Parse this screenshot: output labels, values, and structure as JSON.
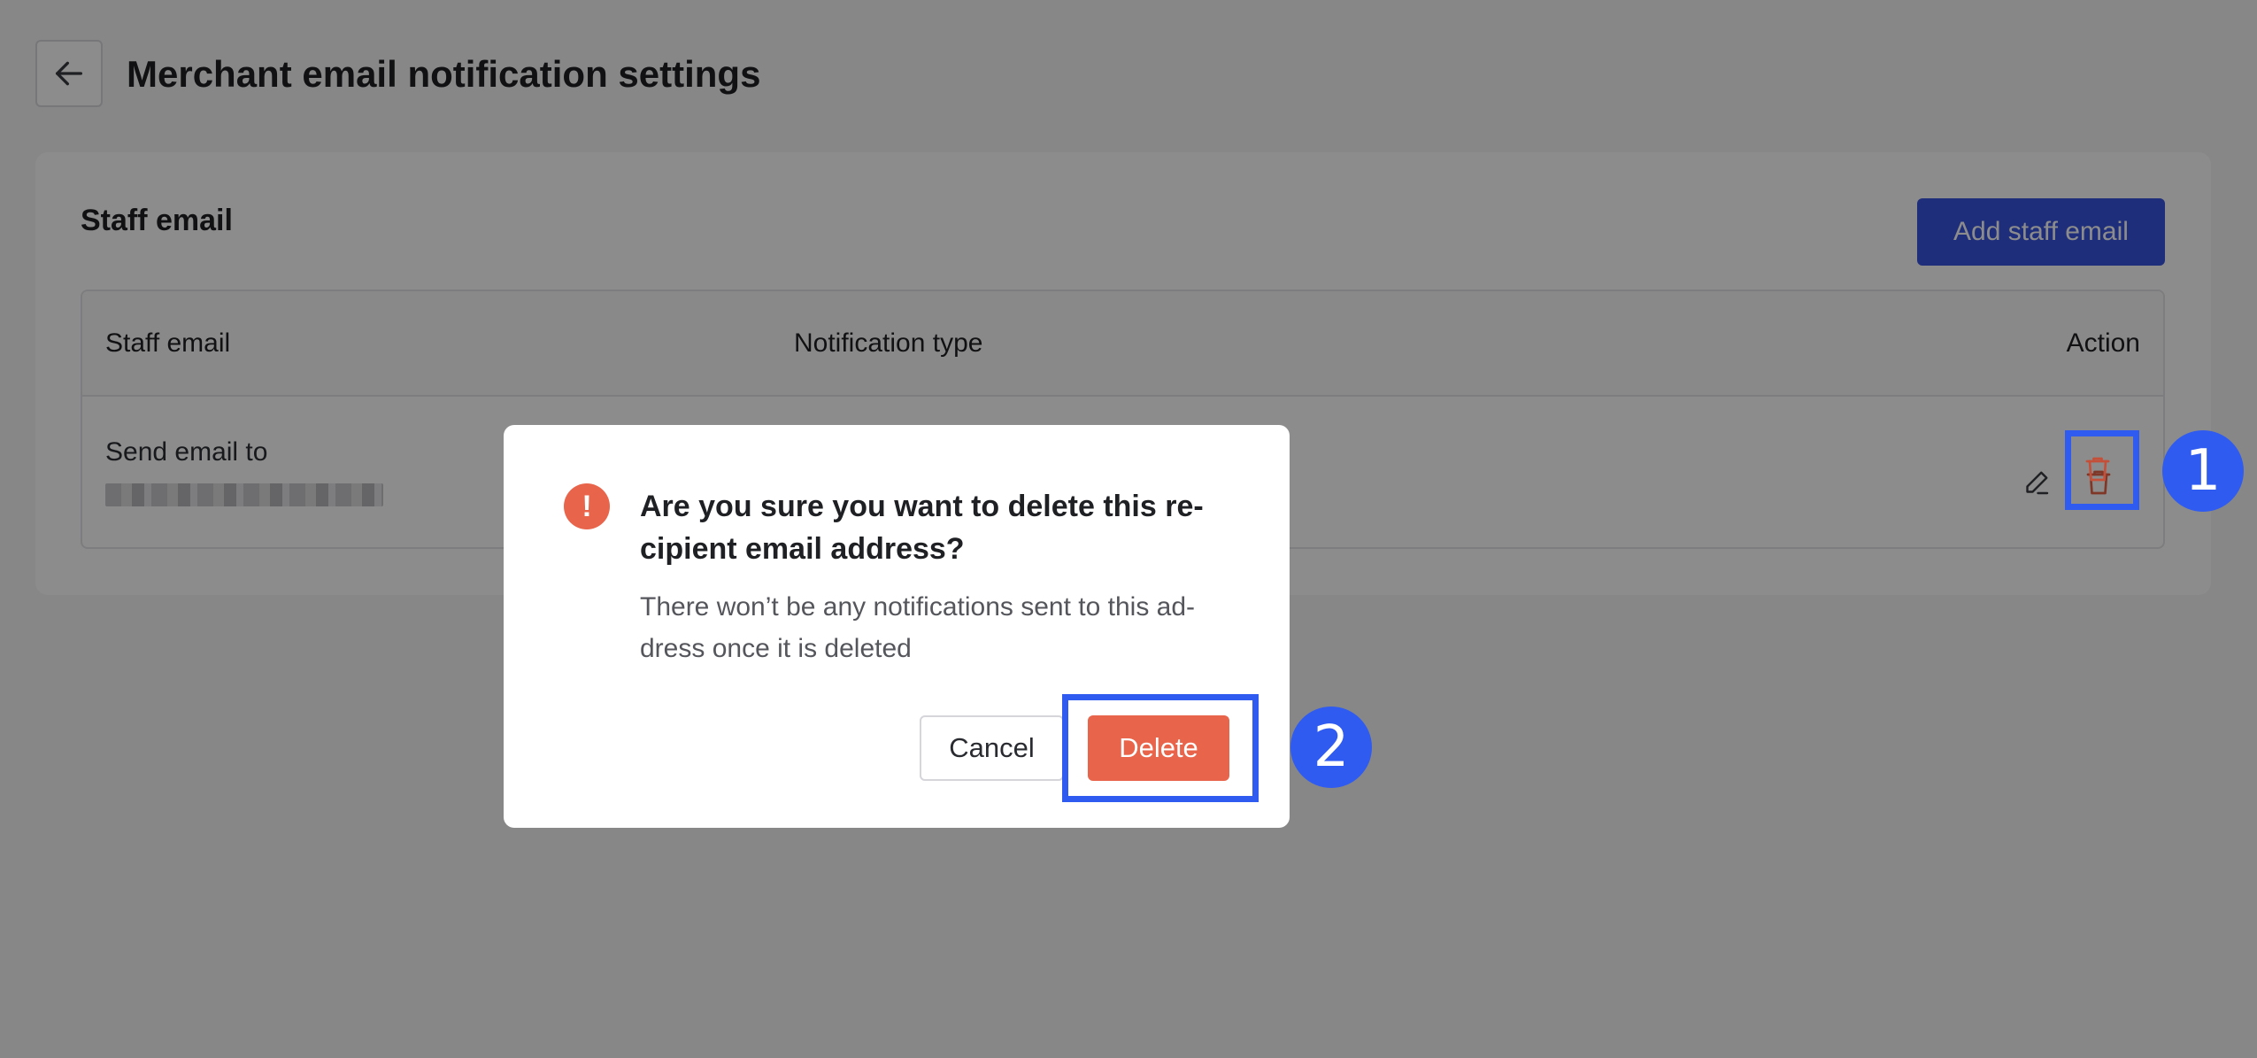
{
  "page": {
    "title": "Merchant email notification settings"
  },
  "staff_card": {
    "title": "Staff email",
    "add_button_label": "Add staff email",
    "table": {
      "columns": [
        "Staff email",
        "Notification type",
        "Action"
      ],
      "rows": [
        {
          "label": "Send email to",
          "email": "(redacted)"
        }
      ]
    }
  },
  "dialog": {
    "title": "Are you sure you want to delete this re-cipient email address?",
    "title_line1": "Are you sure you want to delete this re-",
    "title_line2": "cipient email address?",
    "body_line1": "There won’t be any notifications sent to this ad-",
    "body_line2": "dress once it is deleted",
    "icon_glyph": "!",
    "cancel_label": "Cancel",
    "delete_label": "Delete"
  },
  "annotations": [
    {
      "number": "1",
      "target": "trash-icon"
    },
    {
      "number": "2",
      "target": "delete-button"
    }
  ],
  "colors": {
    "primary": "#3a55e0",
    "danger": "#e8644a",
    "annotation": "#2f5bf0"
  }
}
